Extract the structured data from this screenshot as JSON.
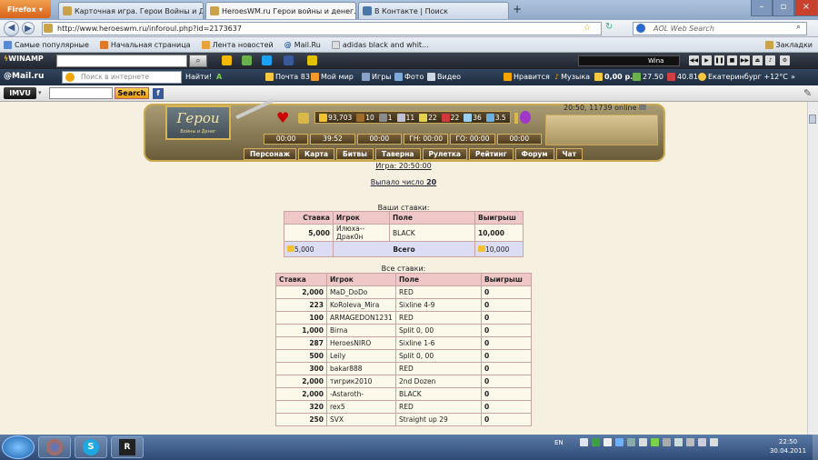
{
  "browser": {
    "app_button": "Firefox",
    "tabs": [
      {
        "label": "Карточная игра. Герои Войны и Де...",
        "active": false
      },
      {
        "label": "HeroesWM.ru Герои войны и денег...",
        "active": true
      },
      {
        "label": "В Контакте | Поиск",
        "active": false
      }
    ],
    "new_tab": "+",
    "url": "http://www.heroeswm.ru/inforoul.php?id=2173637",
    "search_placeholder": "AOL Web Search",
    "bookmarks": [
      "Самые популярные",
      "Начальная страница",
      "Лента новостей",
      "Mail.Ru",
      "adidas black and whit..."
    ],
    "bookmarks_menu": "Закладки"
  },
  "winamp": {
    "logo": "WINAMP",
    "track": "Wina"
  },
  "mailru": {
    "logo": "@Mail.ru",
    "search_placeholder": "Поиск в интернете",
    "find": "Найти!",
    "mail": "Почта 83",
    "myworld": "Мой мир",
    "games": "Игры",
    "photo": "Фото",
    "video": "Видео",
    "like": "Нравится",
    "music": "Музыка",
    "money": "0,00 р.",
    "rate1": "27.50",
    "rate2": "40.81",
    "weather": "Екатеринбург +12°C"
  },
  "imvu": {
    "logo": "IMVU",
    "search_button": "Search"
  },
  "game": {
    "title": "Герои",
    "subtitle": "Войны и Денег",
    "resources": [
      "93,703",
      "10",
      "1",
      "11",
      "22",
      "22",
      "36",
      "3.5"
    ],
    "online": "20:50, 11739 online",
    "timers": [
      "00:00",
      "39:52",
      "00:00",
      "ГН: 00:00",
      "ГО: 00:00",
      "00:00"
    ],
    "menu": [
      "Персонаж",
      "Карта",
      "Битвы",
      "Таверна",
      "Рулетка",
      "Рейтинг",
      "Форум",
      "Чат"
    ],
    "game_time": "Игра: 20:50:00",
    "drawn_label": "Выпало число",
    "drawn_number": "20",
    "my_bets_caption": "Ваши ставки:",
    "all_bets_caption": "Все ставки:",
    "headers": [
      "Ставка",
      "Игрок",
      "Поле",
      "Выигрыш"
    ],
    "my_bets": [
      {
        "bet": "5,000",
        "player": "Илюха--Драк0н",
        "field": "BLACK",
        "win": "10,000"
      }
    ],
    "my_total": {
      "bet": "5,000",
      "label": "Всего",
      "win": "10,000"
    },
    "all_bets": [
      {
        "bet": "2,000",
        "player": "MaD_DoDo",
        "field": "RED",
        "win": "0"
      },
      {
        "bet": "223",
        "player": "KoRoleva_Mira",
        "field": "Sixline 4-9",
        "win": "0"
      },
      {
        "bet": "100",
        "player": "ARMAGEDON1231",
        "field": "RED",
        "win": "0"
      },
      {
        "bet": "1,000",
        "player": "Birna",
        "field": "Split 0, 00",
        "win": "0"
      },
      {
        "bet": "287",
        "player": "HeroesNIRO",
        "field": "Sixline 1-6",
        "win": "0"
      },
      {
        "bet": "500",
        "player": "Leily",
        "field": "Split 0, 00",
        "win": "0"
      },
      {
        "bet": "300",
        "player": "bakar888",
        "field": "RED",
        "win": "0"
      },
      {
        "bet": "2,000",
        "player": "тигрик2010",
        "field": "2nd Dozen",
        "win": "0"
      },
      {
        "bet": "2,000",
        "player": "-Astaroth-",
        "field": "BLACK",
        "win": "0"
      },
      {
        "bet": "320",
        "player": "rex5",
        "field": "RED",
        "win": "0"
      },
      {
        "bet": "250",
        "player": "SVX",
        "field": "Straight up 29",
        "win": "0"
      }
    ]
  },
  "taskbar": {
    "lang": "EN",
    "time": "22:50",
    "date": "30.04.2011"
  }
}
